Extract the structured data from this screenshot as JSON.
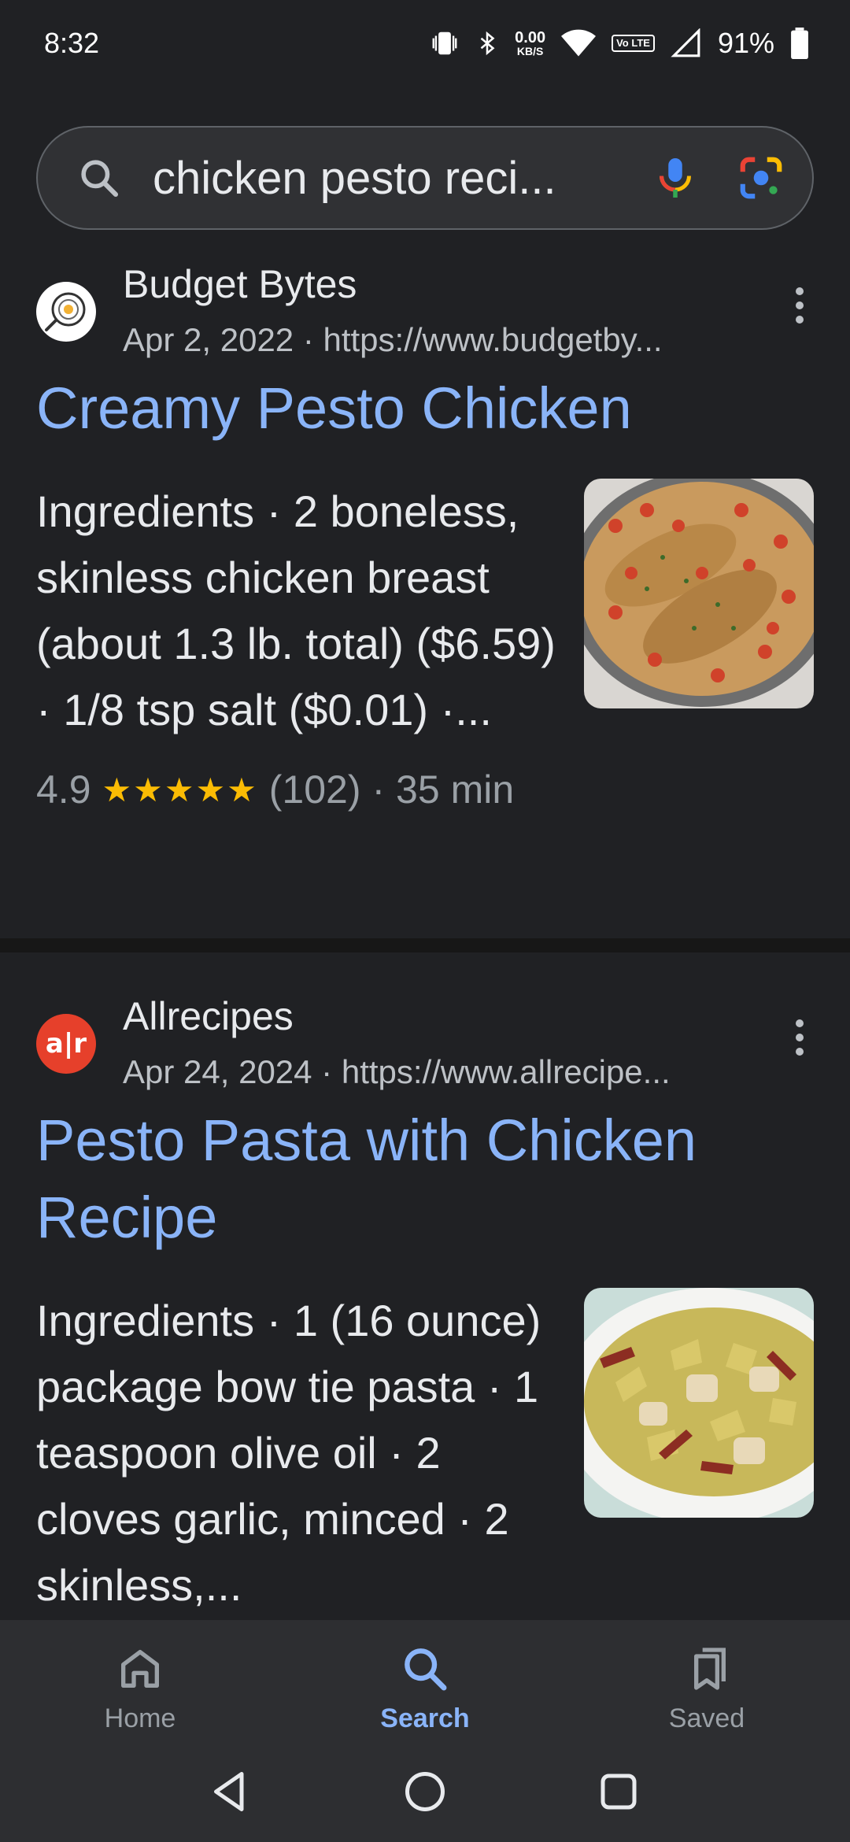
{
  "status_bar": {
    "time": "8:32",
    "net_speed_value": "0.00",
    "net_speed_unit": "KB/S",
    "volte": "Vo LTE",
    "battery": "91%"
  },
  "search": {
    "query": "chicken pesto reci..."
  },
  "results": [
    {
      "site": "Budget Bytes",
      "meta": "Apr 2, 2022 · https://www.budgetby...",
      "title": "Creamy Pesto Chicken",
      "snippet": "Ingredients · 2 boneless, skinless chicken breast (about 1.3 lb. total) ($6.59) · 1/8 tsp salt ($0.01) ·...",
      "rating": "4.9",
      "stars": "★★★★★",
      "reviews": "(102)",
      "time": "· 35 min"
    },
    {
      "site": "Allrecipes",
      "favicon_text": "a|r",
      "meta": "Apr 24, 2024 · https://www.allrecipe...",
      "title": "Pesto Pasta with Chicken Recipe",
      "snippet": "Ingredients · 1 (16 ounce) package bow tie pasta · 1 teaspoon olive oil · 2 cloves garlic, minced · 2 skinless,..."
    }
  ],
  "bottom_nav": {
    "home": "Home",
    "search": "Search",
    "saved": "Saved"
  },
  "colors": {
    "background": "#202124",
    "link": "#8ab4f8",
    "star": "#fbbc04",
    "allrecipes_brand": "#e6402b"
  }
}
